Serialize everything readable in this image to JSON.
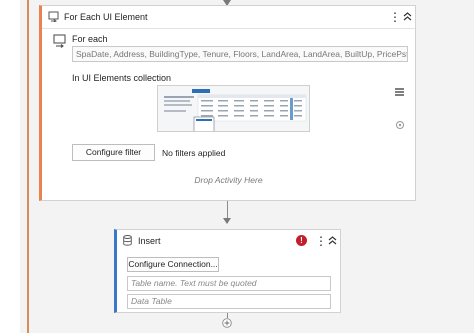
{
  "foreach": {
    "title": "For Each UI Element",
    "for_each_label": "For each",
    "for_each_value": "SpaDate, Address, BuildingType, Tenure, Floors, LandArea, LandArea, BuiltUp, PricePsf, Price",
    "collection_label": "In UI Elements collection",
    "configure_filter_label": "Configure filter",
    "filter_status": "No filters applied",
    "drop_hint": "Drop Activity Here"
  },
  "insert": {
    "title": "Insert",
    "configure_connection_label": "Configure Connection...",
    "table_name_placeholder": "Table name. Text must be quoted",
    "data_table_placeholder": "Data Table",
    "error_glyph": "!"
  },
  "icons": {
    "foreach_header": "loop-icon",
    "foreach_body": "loop-icon",
    "insert": "database-icon",
    "error": "error-icon",
    "more": "kebab-icon",
    "collapse": "chevron-up-double-icon",
    "list": "hamburger-icon",
    "target": "target-icon",
    "add": "plus-circle-icon"
  },
  "colors": {
    "foreach_accent": "#e8834f",
    "insert_accent": "#3a78c9",
    "error": "#c21f2c"
  }
}
